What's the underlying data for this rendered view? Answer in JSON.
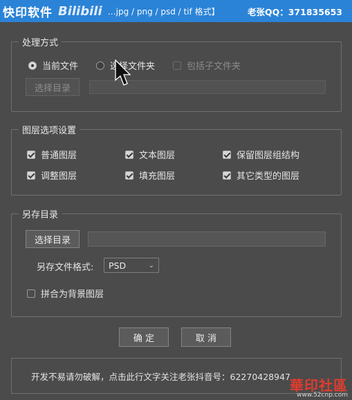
{
  "titlebar": {
    "app_name": "快印软件",
    "watermark": "Bilibili",
    "formats": "…jpg / png / psd / tif 格式】",
    "contact": "老张QQ：371835653"
  },
  "process_mode": {
    "legend": "处理方式",
    "radio_current": "当前文件",
    "radio_folder": "选择文件夹",
    "include_sub": "包括子文件夹",
    "choose_dir": "选择目录"
  },
  "layer_options": {
    "legend": "图层选项设置",
    "items": [
      {
        "label": "普通图层",
        "checked": true
      },
      {
        "label": "文本图层",
        "checked": true
      },
      {
        "label": "保留图层组结构",
        "checked": true
      },
      {
        "label": "调整图层",
        "checked": true
      },
      {
        "label": "填充图层",
        "checked": true
      },
      {
        "label": "其它类型的图层",
        "checked": true
      }
    ]
  },
  "save_dir": {
    "legend": "另存目录",
    "choose_dir": "选择目录",
    "format_label": "另存文件格式:",
    "format_value": "PSD",
    "flatten": "拼合为背景图层"
  },
  "actions": {
    "ok": "确 定",
    "cancel": "取 消"
  },
  "footer": {
    "text": "开发不易请勿破解，点击此行文字关注老张抖音号：62270428947"
  },
  "site_logo": {
    "name": "華印社區",
    "url": "www.52cnp.com"
  },
  "colors": {
    "titlebar": "#2b83d7",
    "background": "#4b4b4b",
    "logo_red": "#e23b2e"
  }
}
